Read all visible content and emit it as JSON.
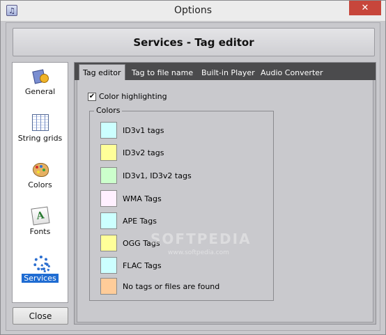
{
  "window": {
    "title": "Options",
    "close_glyph": "✕"
  },
  "header": {
    "title": "Services - Tag editor"
  },
  "sidebar": {
    "items": [
      {
        "label": "General",
        "icon": "general-settings-icon"
      },
      {
        "label": "String grids",
        "icon": "grid-icon"
      },
      {
        "label": "Colors",
        "icon": "palette-icon"
      },
      {
        "label": "Fonts",
        "icon": "font-icon"
      },
      {
        "label": "Services",
        "icon": "gears-icon",
        "selected": true
      }
    ],
    "fonts_glyph": "A"
  },
  "footer": {
    "close_label": "Close"
  },
  "tabs": [
    {
      "label": "Tag editor",
      "active": true
    },
    {
      "label": "Tag to file name"
    },
    {
      "label": "Built-in Player"
    },
    {
      "label": "Audio Converter"
    }
  ],
  "tag_editor": {
    "color_highlighting": {
      "label": "Color highlighting",
      "checked": true,
      "check_glyph": "✔"
    },
    "colors_group": {
      "title": "Colors",
      "entries": [
        {
          "label": "ID3v1 tags",
          "color": "#ccffff"
        },
        {
          "label": "ID3v2 tags",
          "color": "#ffff99"
        },
        {
          "label": "ID3v1, ID3v2 tags",
          "color": "#ccffcc"
        },
        {
          "label": "WMA Tags",
          "color": "#fff0ff"
        },
        {
          "label": "APE Tags",
          "color": "#ccffff"
        },
        {
          "label": "OGG Tags",
          "color": "#ffff99"
        },
        {
          "label": "FLAC Tags",
          "color": "#ccffff"
        },
        {
          "label": "No tags or files are found",
          "color": "#ffcc99"
        }
      ]
    }
  },
  "watermark": {
    "text": "SOFTPEDIA",
    "sub": "www.softpedia.com"
  }
}
